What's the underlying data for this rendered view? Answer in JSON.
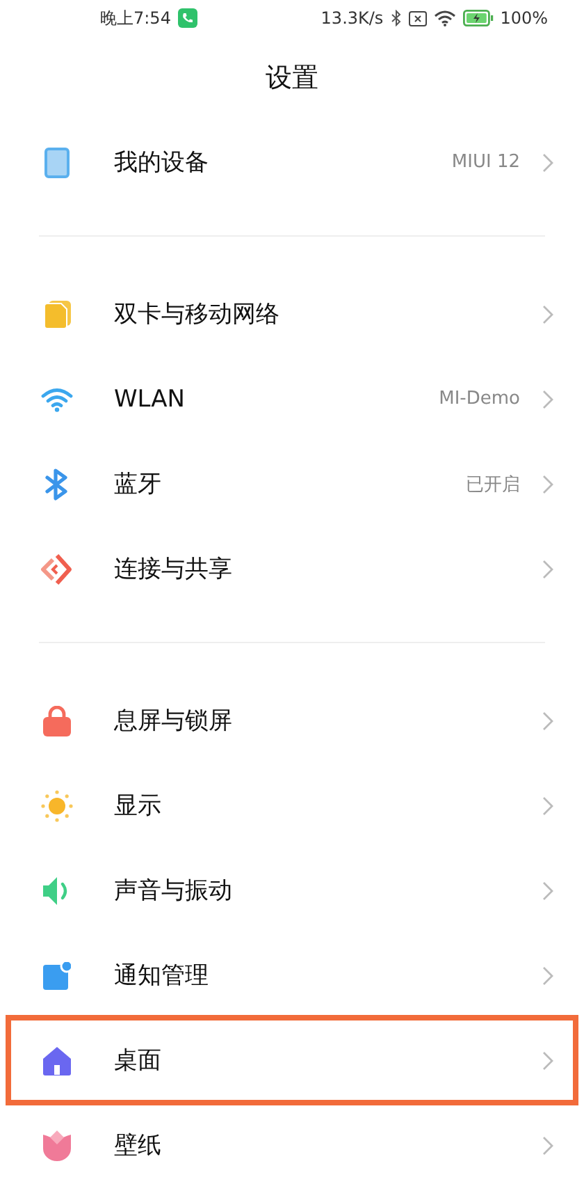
{
  "status_bar": {
    "time": "晚上7:54",
    "speed": "13.3K/s",
    "battery": "100%"
  },
  "title": "设置",
  "sections": [
    {
      "items": [
        {
          "label": "我的设备",
          "value": "MIUI 12",
          "highlighted": false
        }
      ]
    },
    {
      "items": [
        {
          "label": "双卡与移动网络",
          "highlighted": false
        },
        {
          "label": "WLAN",
          "value": "MI-Demo",
          "highlighted": false
        },
        {
          "label": "蓝牙",
          "value": "已开启",
          "highlighted": false
        },
        {
          "label": "连接与共享",
          "highlighted": false
        }
      ]
    },
    {
      "items": [
        {
          "label": "息屏与锁屏",
          "highlighted": false
        },
        {
          "label": "显示",
          "highlighted": false
        },
        {
          "label": "声音与振动",
          "highlighted": false
        },
        {
          "label": "通知管理",
          "highlighted": false
        },
        {
          "label": "桌面",
          "highlighted": true
        },
        {
          "label": "壁纸",
          "highlighted": false
        }
      ]
    }
  ]
}
